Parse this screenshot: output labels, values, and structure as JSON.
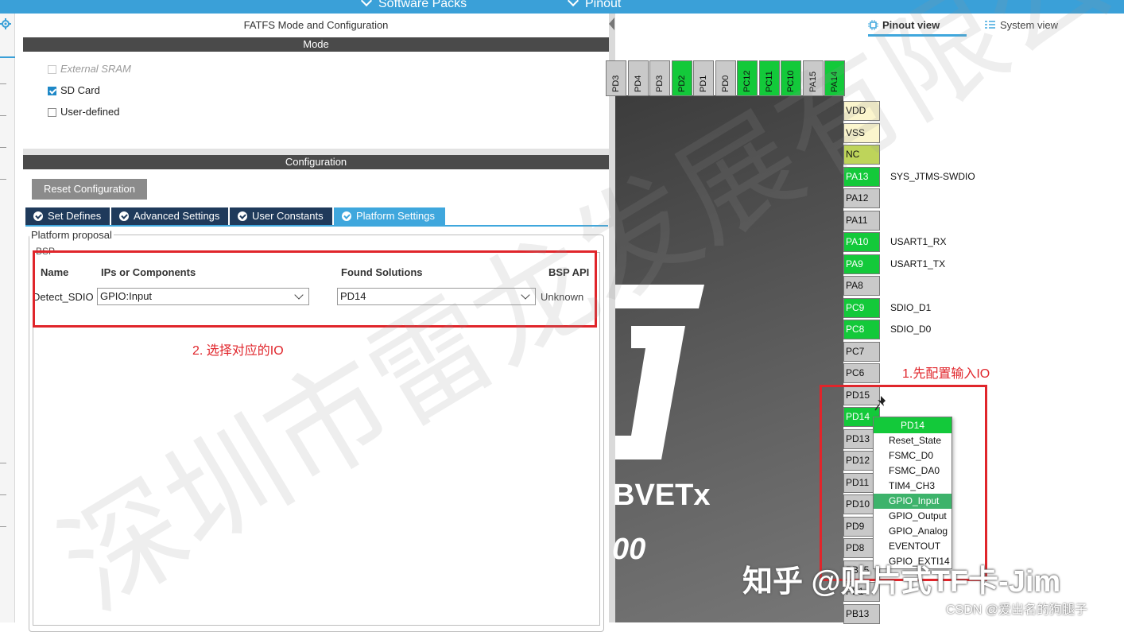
{
  "top_menu": {
    "software_packs": "Software Packs",
    "pinout": "Pinout"
  },
  "config_panel": {
    "title": "FATFS Mode and Configuration",
    "mode_header": "Mode",
    "mode_options": [
      {
        "label": "External SRAM",
        "checked": false,
        "disabled": true
      },
      {
        "label": "SD Card",
        "checked": true,
        "disabled": false
      },
      {
        "label": "User-defined",
        "checked": false,
        "disabled": false
      }
    ],
    "configuration_header": "Configuration",
    "reset_button": "Reset Configuration",
    "tabs": [
      "Set Defines",
      "Advanced Settings",
      "User Constants",
      "Platform Settings"
    ],
    "active_tab": "Platform Settings",
    "platform_proposal_legend": "Platform proposal",
    "bsp_legend": "BSP",
    "table": {
      "headers": {
        "name": "Name",
        "ips": "IPs or Components",
        "found": "Found Solutions",
        "bsp_api": "BSP API"
      },
      "row": {
        "name": "Detect_SDIO",
        "ips": "GPIO:Input",
        "found": "PD14",
        "bsp_api": "Unknown"
      }
    },
    "annotation": "2. 选择对应的IO"
  },
  "pinout_panel": {
    "pinout_view_tab": "Pinout view",
    "system_view_tab": "System view",
    "chip_name_fragment": "BVETx",
    "chip_fragment_2": "00",
    "top_pins": [
      "PD3",
      "PD4",
      "PD3",
      "PD2",
      "PD1",
      "PD0",
      "PC12",
      "PC11",
      "PC10",
      "PA15",
      "PA14"
    ],
    "right_pins": [
      {
        "pin": "VDD",
        "func": ""
      },
      {
        "pin": "VSS",
        "func": ""
      },
      {
        "pin": "NC",
        "func": ""
      },
      {
        "pin": "PA13",
        "func": "SYS_JTMS-SWDIO"
      },
      {
        "pin": "PA12",
        "func": ""
      },
      {
        "pin": "PA11",
        "func": ""
      },
      {
        "pin": "PA10",
        "func": "USART1_RX"
      },
      {
        "pin": "PA9",
        "func": "USART1_TX"
      },
      {
        "pin": "PA8",
        "func": ""
      },
      {
        "pin": "PC9",
        "func": "SDIO_D1"
      },
      {
        "pin": "PC8",
        "func": "SDIO_D0"
      },
      {
        "pin": "PC7",
        "func": ""
      },
      {
        "pin": "PC6",
        "func": ""
      },
      {
        "pin": "PD15",
        "func": ""
      },
      {
        "pin": "PD14",
        "func": ""
      },
      {
        "pin": "PD13",
        "func": ""
      },
      {
        "pin": "PD12",
        "func": ""
      },
      {
        "pin": "PD11",
        "func": ""
      },
      {
        "pin": "PD10",
        "func": ""
      },
      {
        "pin": "PD9",
        "func": ""
      },
      {
        "pin": "PD8",
        "func": ""
      },
      {
        "pin": "PB15",
        "func": ""
      },
      {
        "pin": "PB14",
        "func": ""
      },
      {
        "pin": "PB13",
        "func": ""
      }
    ],
    "annotation": "1.先配置输入IO",
    "context_menu": {
      "header": "PD14",
      "items": [
        "Reset_State",
        "FSMC_D0",
        "FSMC_DA0",
        "TIM4_CH3",
        "GPIO_Input",
        "GPIO_Output",
        "GPIO_Analog",
        "EVENTOUT",
        "GPIO_EXTI14"
      ],
      "selected": "GPIO_Input"
    }
  },
  "watermarks": {
    "diagonal": "深圳市雷龙发展有限公司",
    "zhihu": "知乎 @贴片式TF卡-Jim",
    "csdn": "CSDN @爱出名的狗腿子"
  },
  "colors": {
    "accent": "#3fa7dd",
    "pin_green": "#13c93a",
    "annotation_red": "#e0252b",
    "tab_dark": "#1f3a5b"
  }
}
